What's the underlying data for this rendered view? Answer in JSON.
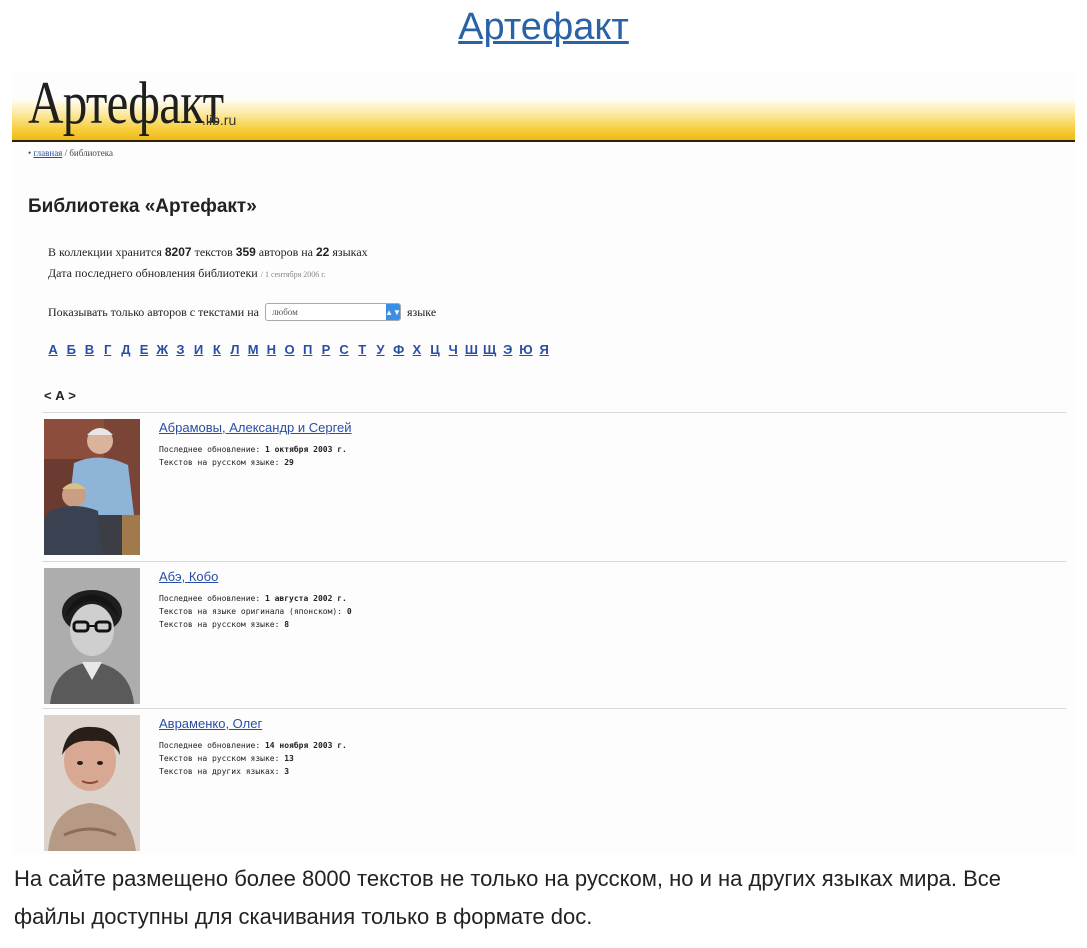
{
  "top_link": "Артефакт",
  "site": {
    "logo": "Артефакт",
    "logo_suffix": ".lib.ru"
  },
  "breadcrumb": {
    "home": "главная",
    "separator": " / ",
    "current": "библиотека"
  },
  "page_title": "Библиотека «Артефакт»",
  "stats": {
    "line1_a": "В коллекции хранится ",
    "texts_count": "8207",
    "line1_b": " текстов ",
    "authors_count": "359",
    "line1_c": " авторов на ",
    "languages_count": "22",
    "line1_d": " языках",
    "line2": "Дата последнего обновления библиотеки",
    "updated": "/ 1 сентября 2006 г."
  },
  "filter": {
    "label_before": "Показывать только авторов с текстами на",
    "selected": "любом",
    "label_after": "языке"
  },
  "alphabet": [
    "А",
    "Б",
    "В",
    "Г",
    "Д",
    "Е",
    "Ж",
    "З",
    "И",
    "К",
    "Л",
    "М",
    "Н",
    "О",
    "П",
    "Р",
    "С",
    "Т",
    "У",
    "Ф",
    "Х",
    "Ц",
    "Ч",
    "Ш",
    "Щ",
    "Э",
    "Ю",
    "Я"
  ],
  "letter_nav": {
    "prev": "<",
    "current": "А",
    "next": ">"
  },
  "authors": [
    {
      "name": "Абрамовы, Александр и Сергей",
      "lines": [
        {
          "label": "Последнее обновление: ",
          "value": "1 октября 2003 г."
        },
        {
          "label": "Текстов на русском языке: ",
          "value": "29"
        }
      ]
    },
    {
      "name": "Абэ, Кобо",
      "lines": [
        {
          "label": "Последнее обновление: ",
          "value": "1 августа 2002 г."
        },
        {
          "label": "Текстов на языке оригинала (японском): ",
          "value": "0"
        },
        {
          "label": "Текстов на русском языке: ",
          "value": "8"
        }
      ]
    },
    {
      "name": "Авраменко, Олег",
      "lines": [
        {
          "label": "Последнее обновление: ",
          "value": "14 ноября 2003 г."
        },
        {
          "label": "Текстов на русском языке: ",
          "value": "13"
        },
        {
          "label": "Текстов на других языках: ",
          "value": "3"
        }
      ]
    }
  ],
  "caption": "На сайте размещено более 8000 текстов не только на русском, но и на других языках мира. Все файлы доступны для скачивания только в формате doc."
}
